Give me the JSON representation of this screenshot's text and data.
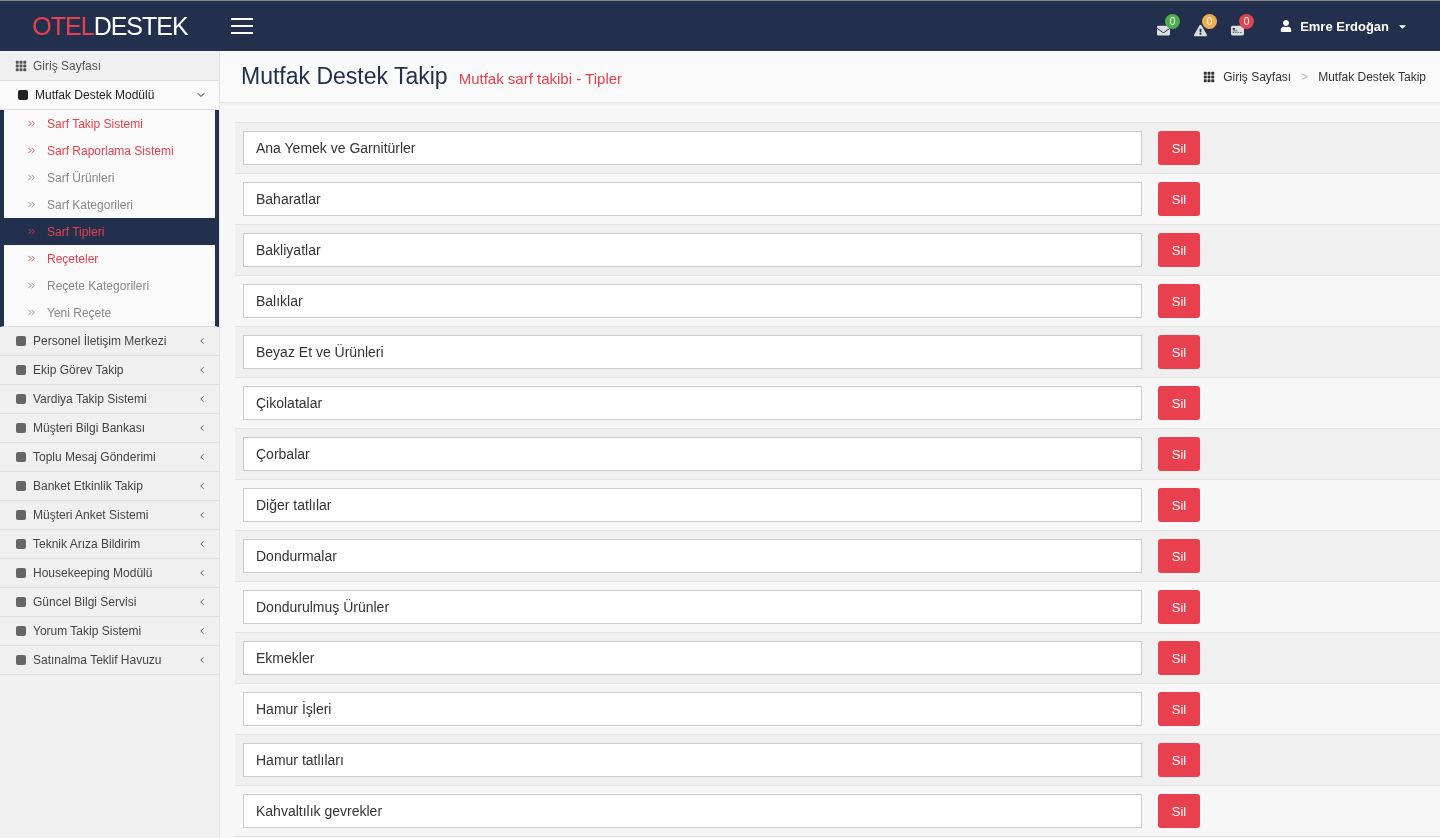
{
  "header": {
    "logo_part_1": "OTEL",
    "logo_part_2": "DESTEK",
    "notifications": [
      {
        "kind": "mail",
        "count": "0",
        "color": "#4cae4c"
      },
      {
        "kind": "warning",
        "count": "0",
        "color": "#f0ad4e"
      },
      {
        "kind": "card",
        "count": "0",
        "color": "#e0464e"
      }
    ],
    "user": {
      "name": "Emre Erdoğan"
    }
  },
  "sidebar": {
    "home": "Giriş Sayfası",
    "modules": [
      {
        "label": "Mutfak Destek Modülü",
        "expanded": true,
        "children": [
          {
            "label": "Sarf Takip Sistemi",
            "highlighted": true,
            "selected": false
          },
          {
            "label": "Sarf Raporlama Sistemi",
            "highlighted": true,
            "selected": false
          },
          {
            "label": "Sarf Ürünleri",
            "highlighted": false,
            "selected": false
          },
          {
            "label": "Sarf Kategorileri",
            "highlighted": false,
            "selected": false
          },
          {
            "label": "Sarf Tipleri",
            "highlighted": true,
            "selected": true
          },
          {
            "label": "Reçeteler",
            "highlighted": true,
            "selected": false
          },
          {
            "label": "Reçete Kategorileri",
            "highlighted": false,
            "selected": false
          },
          {
            "label": "Yeni Reçete",
            "highlighted": false,
            "selected": false
          }
        ]
      },
      {
        "label": "Personel İletişim Merkezi",
        "expanded": false
      },
      {
        "label": "Ekip Görev Takip",
        "expanded": false
      },
      {
        "label": "Vardiya Takip Sistemi",
        "expanded": false
      },
      {
        "label": "Müşteri Bilgi Bankası",
        "expanded": false
      },
      {
        "label": "Toplu Mesaj Gönderimi",
        "expanded": false
      },
      {
        "label": "Banket Etkinlik Takip",
        "expanded": false
      },
      {
        "label": "Müşteri Anket Sistemi",
        "expanded": false
      },
      {
        "label": "Teknik Arıza Bildirim",
        "expanded": false
      },
      {
        "label": "Housekeeping Modülü",
        "expanded": false
      },
      {
        "label": "Güncel Bilgi Servisi",
        "expanded": false
      },
      {
        "label": "Yorum Takip Sistemi",
        "expanded": false
      },
      {
        "label": "Satınalma Teklif Havuzu",
        "expanded": false
      }
    ]
  },
  "page": {
    "title": "Mutfak Destek Takip",
    "subtitle": "Mutfak sarf takibi - Tipler",
    "breadcrumb": [
      "Giriş Sayfası",
      "Mutfak Destek Takip"
    ],
    "breadcrumb_separator": ">"
  },
  "types": [
    {
      "value": "Ana Yemek ve Garnitürler",
      "button": "Sil"
    },
    {
      "value": "Baharatlar",
      "button": "Sil"
    },
    {
      "value": "Bakliyatlar",
      "button": "Sil"
    },
    {
      "value": "Balıklar",
      "button": "Sil"
    },
    {
      "value": "Beyaz Et ve Ürünleri",
      "button": "Sil"
    },
    {
      "value": "Çikolatalar",
      "button": "Sil"
    },
    {
      "value": "Çorbalar",
      "button": "Sil"
    },
    {
      "value": "Diğer tatlılar",
      "button": "Sil"
    },
    {
      "value": "Dondurmalar",
      "button": "Sil"
    },
    {
      "value": "Dondurulmuş Ürünler",
      "button": "Sil"
    },
    {
      "value": "Ekmekler",
      "button": "Sil"
    },
    {
      "value": "Hamur İşleri",
      "button": "Sil"
    },
    {
      "value": "Hamur tatlıları",
      "button": "Sil"
    },
    {
      "value": "Kahvaltılık gevrekler",
      "button": "Sil"
    }
  ]
}
